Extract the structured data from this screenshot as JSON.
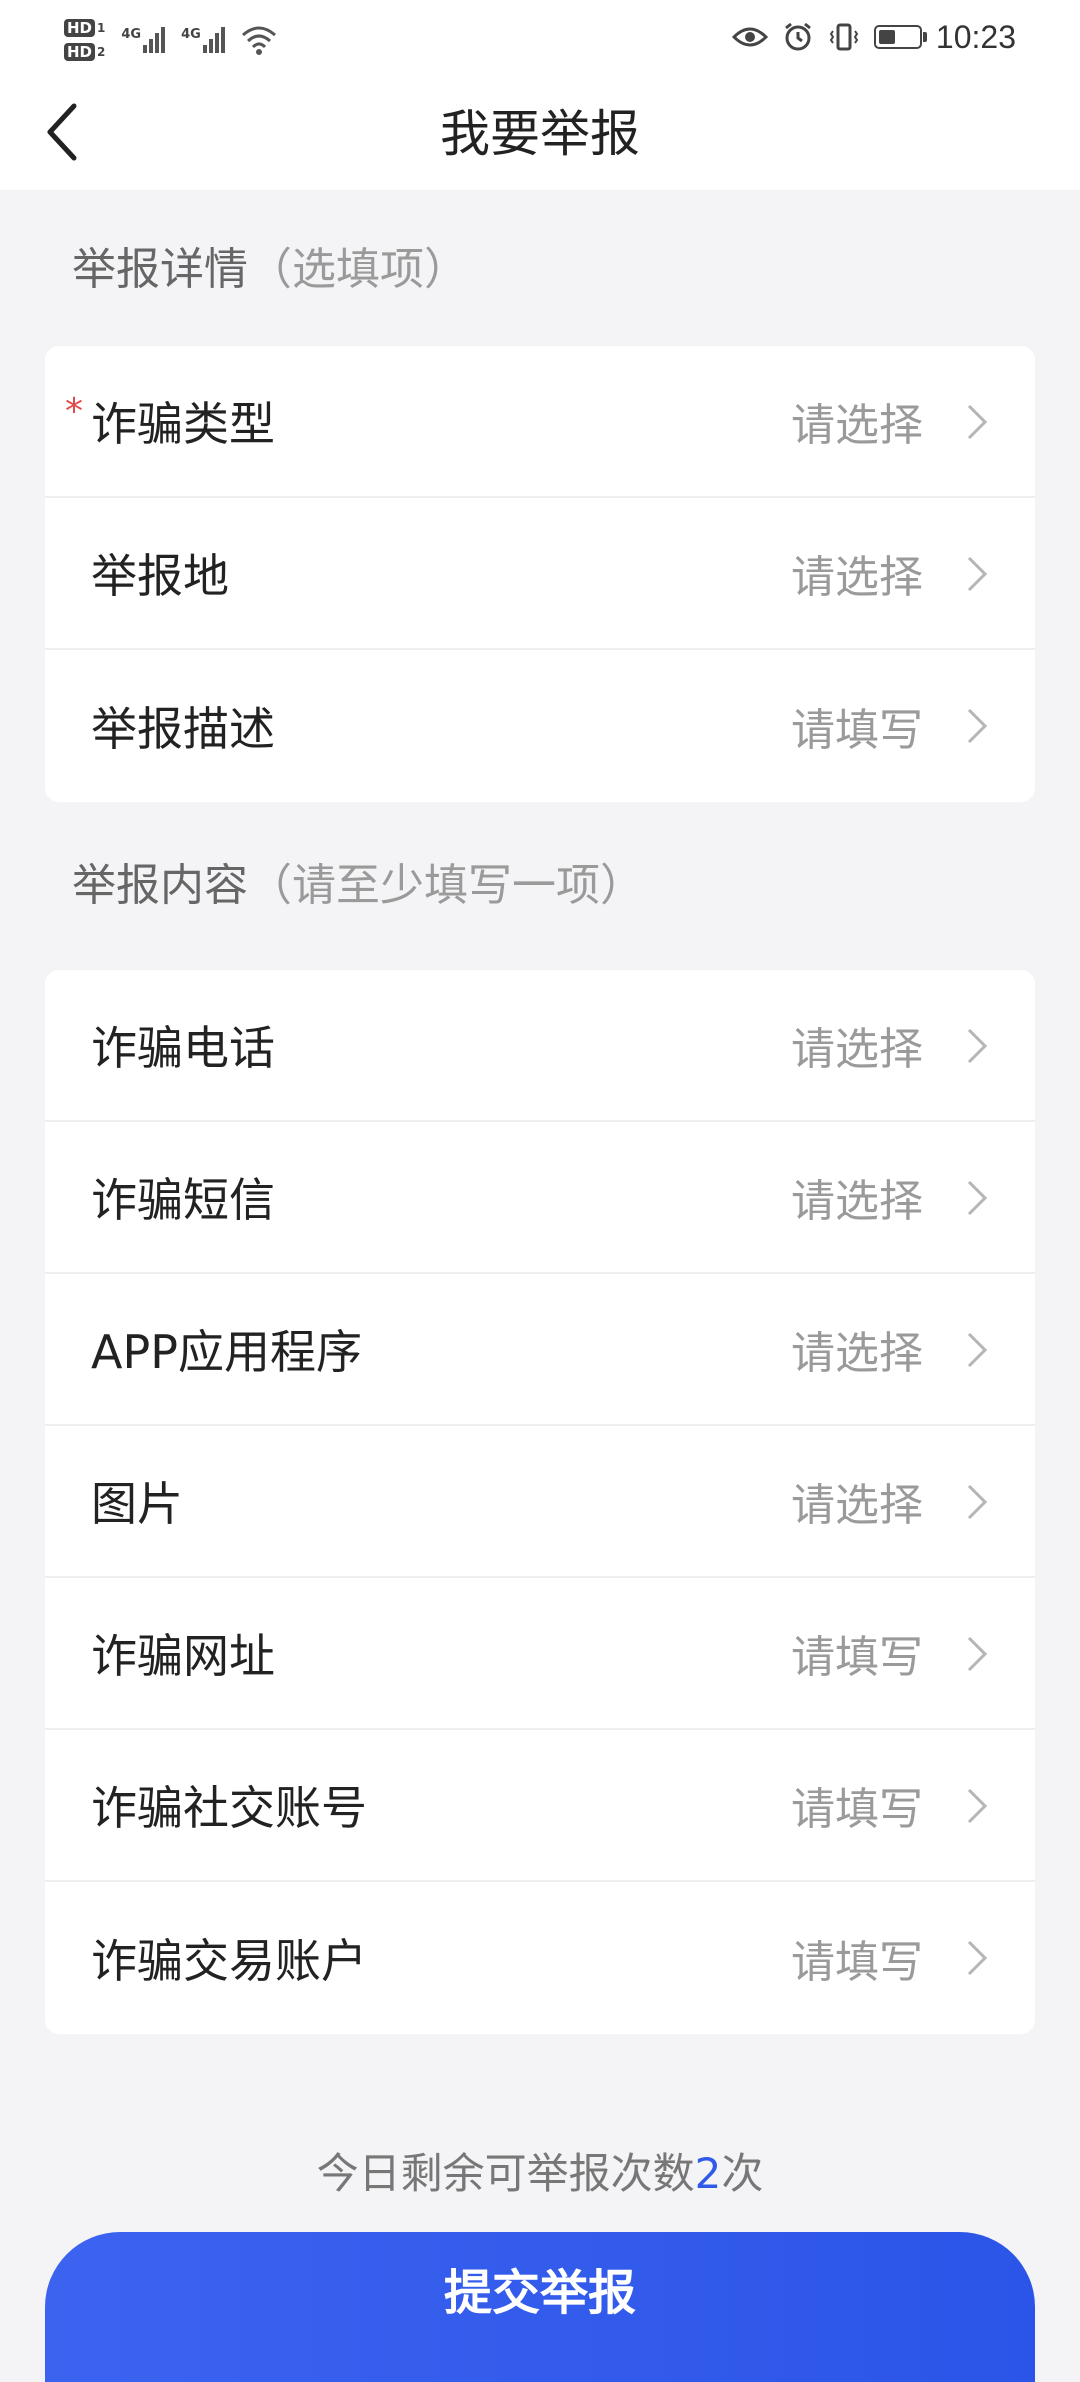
{
  "status_bar": {
    "sim1_label": "HD",
    "sim1_num": "1",
    "sim2_label": "HD",
    "sim2_num": "2",
    "network1": "4G",
    "network2": "4G",
    "time": "10:23",
    "icons": [
      "wifi-icon",
      "eye-icon",
      "alarm-icon",
      "vibrate-icon",
      "battery-icon"
    ]
  },
  "header": {
    "title": "我要举报",
    "back_icon": "chevron-left-icon"
  },
  "section_details": {
    "title": "举报详情",
    "note": "（选填项）",
    "items": [
      {
        "label": "诈骗类型",
        "value": "请选择",
        "required": "*"
      },
      {
        "label": "举报地",
        "value": "请选择"
      },
      {
        "label": "举报描述",
        "value": "请填写"
      }
    ]
  },
  "section_content": {
    "title": "举报内容",
    "note": "（请至少填写一项）",
    "items": [
      {
        "label": "诈骗电话",
        "value": "请选择"
      },
      {
        "label": "诈骗短信",
        "value": "请选择"
      },
      {
        "label": "APP应用程序",
        "value": "请选择"
      },
      {
        "label": "图片",
        "value": "请选择"
      },
      {
        "label": "诈骗网址",
        "value": "请填写"
      },
      {
        "label": "诈骗社交账号",
        "value": "请填写"
      },
      {
        "label": "诈骗交易账户",
        "value": "请填写"
      }
    ]
  },
  "footer": {
    "remaining_prefix": "今日剩余可举报次数",
    "remaining_count": "2",
    "remaining_suffix": "次",
    "submit_label": "提交举报"
  },
  "colors": {
    "accent": "#2f5be8",
    "required": "#e04a4a",
    "background": "#f4f4f6",
    "placeholder": "#9a9a9a"
  }
}
